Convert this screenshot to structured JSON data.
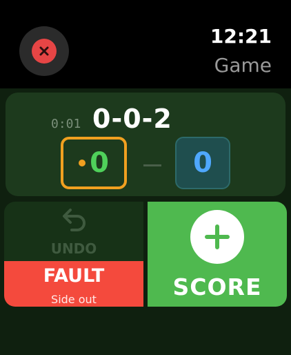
{
  "status_bar": {
    "time": "12:21",
    "title": "Game"
  },
  "scoreboard": {
    "timer": "0:01",
    "set_score": "0-0-2",
    "team_left": {
      "score": "0",
      "serving": true
    },
    "separator": "—",
    "team_right": {
      "score": "0"
    }
  },
  "actions": {
    "undo_label": "UNDO",
    "fault_label": "FAULT",
    "fault_sublabel": "Side out",
    "score_label": "SCORE"
  },
  "colors": {
    "close_red": "#e64545",
    "serve_orange": "#f0a020",
    "team_left_green": "#4fd05a",
    "team_right_blue": "#4fa8ff",
    "fault_red": "#f44a3d",
    "score_green": "#4fb94f"
  },
  "icons": {
    "close": "x-icon",
    "undo": "undo-arrow-icon",
    "add": "plus-icon"
  }
}
